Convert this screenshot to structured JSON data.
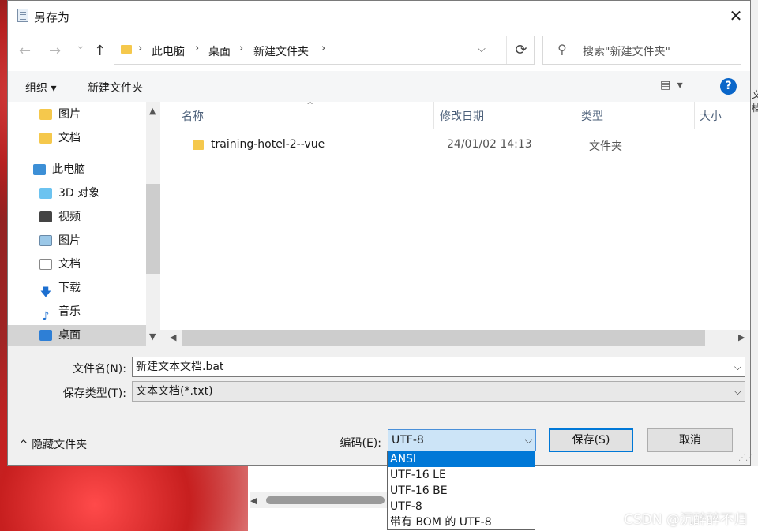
{
  "dialog": {
    "title": "另存为",
    "close": "✕"
  },
  "nav": {
    "back": "←",
    "forward": "→",
    "recent": "⌄",
    "up": "↑",
    "breadcrumb": [
      "此电脑",
      "桌面",
      "新建文件夹"
    ],
    "search_placeholder": "搜索\"新建文件夹\""
  },
  "toolbar": {
    "organize": "组织 ▾",
    "new_folder": "新建文件夹",
    "view": "▤ ▾",
    "help": "?"
  },
  "sidebar": {
    "items": [
      {
        "label": "图片",
        "icon": "folder-icon"
      },
      {
        "label": "文档",
        "icon": "folder-icon"
      },
      {
        "label": "此电脑",
        "icon": "computer-icon"
      },
      {
        "label": "3D 对象",
        "icon": "3d-objects-icon"
      },
      {
        "label": "视频",
        "icon": "video-icon"
      },
      {
        "label": "图片",
        "icon": "pictures-icon"
      },
      {
        "label": "文档",
        "icon": "documents-icon"
      },
      {
        "label": "下载",
        "icon": "download-icon"
      },
      {
        "label": "音乐",
        "icon": "music-icon"
      },
      {
        "label": "桌面",
        "icon": "desktop-icon",
        "selected": true
      }
    ]
  },
  "columns": {
    "name": "名称",
    "date": "修改日期",
    "type": "类型",
    "size": "大小"
  },
  "files": [
    {
      "name": "training-hotel-2--vue",
      "date": "24/01/02 14:13",
      "type": "文件夹"
    }
  ],
  "form": {
    "filename_label": "文件名(N):",
    "filename_value": "新建文本文档.bat",
    "filetype_label": "保存类型(T):",
    "filetype_value": "文本文档(*.txt)",
    "hide_folders": "隐藏文件夹",
    "encoding_label": "编码(E):",
    "encoding_value": "UTF-8",
    "save": "保存(S)",
    "cancel": "取消"
  },
  "encoding_options": [
    "ANSI",
    "UTF-16 LE",
    "UTF-16 BE",
    "UTF-8",
    "带有 BOM 的 UTF-8"
  ],
  "encoding_highlighted": "ANSI",
  "background": {
    "watermark": "CSDN @沉醉醉不归",
    "side_peek": "文档"
  },
  "colors": {
    "accent": "#0078d7",
    "help": "#0a66c9",
    "folder": "#f5c84c"
  }
}
